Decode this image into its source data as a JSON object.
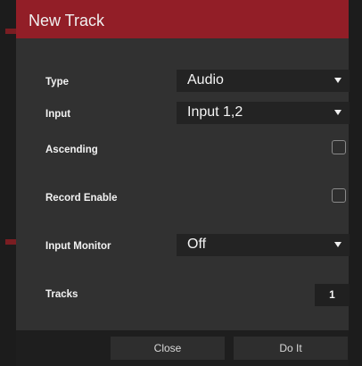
{
  "dialog": {
    "title": "New Track",
    "rows": {
      "type": {
        "label": "Type",
        "value": "Audio"
      },
      "input": {
        "label": "Input",
        "value": "Input 1,2"
      },
      "ascending": {
        "label": "Ascending",
        "checked": false
      },
      "record_enable": {
        "label": "Record Enable",
        "checked": false
      },
      "input_monitor": {
        "label": "Input Monitor",
        "value": "Off"
      },
      "tracks": {
        "label": "Tracks",
        "value": "1"
      }
    },
    "buttons": {
      "close": "Close",
      "do_it": "Do It"
    }
  },
  "colors": {
    "title_bar": "#921e27",
    "dialog_bg": "#313131",
    "field_bg": "#232323",
    "footer_bg": "#1e1e1e"
  },
  "icons": {
    "dropdown_arrow": "chevron-down-icon"
  }
}
